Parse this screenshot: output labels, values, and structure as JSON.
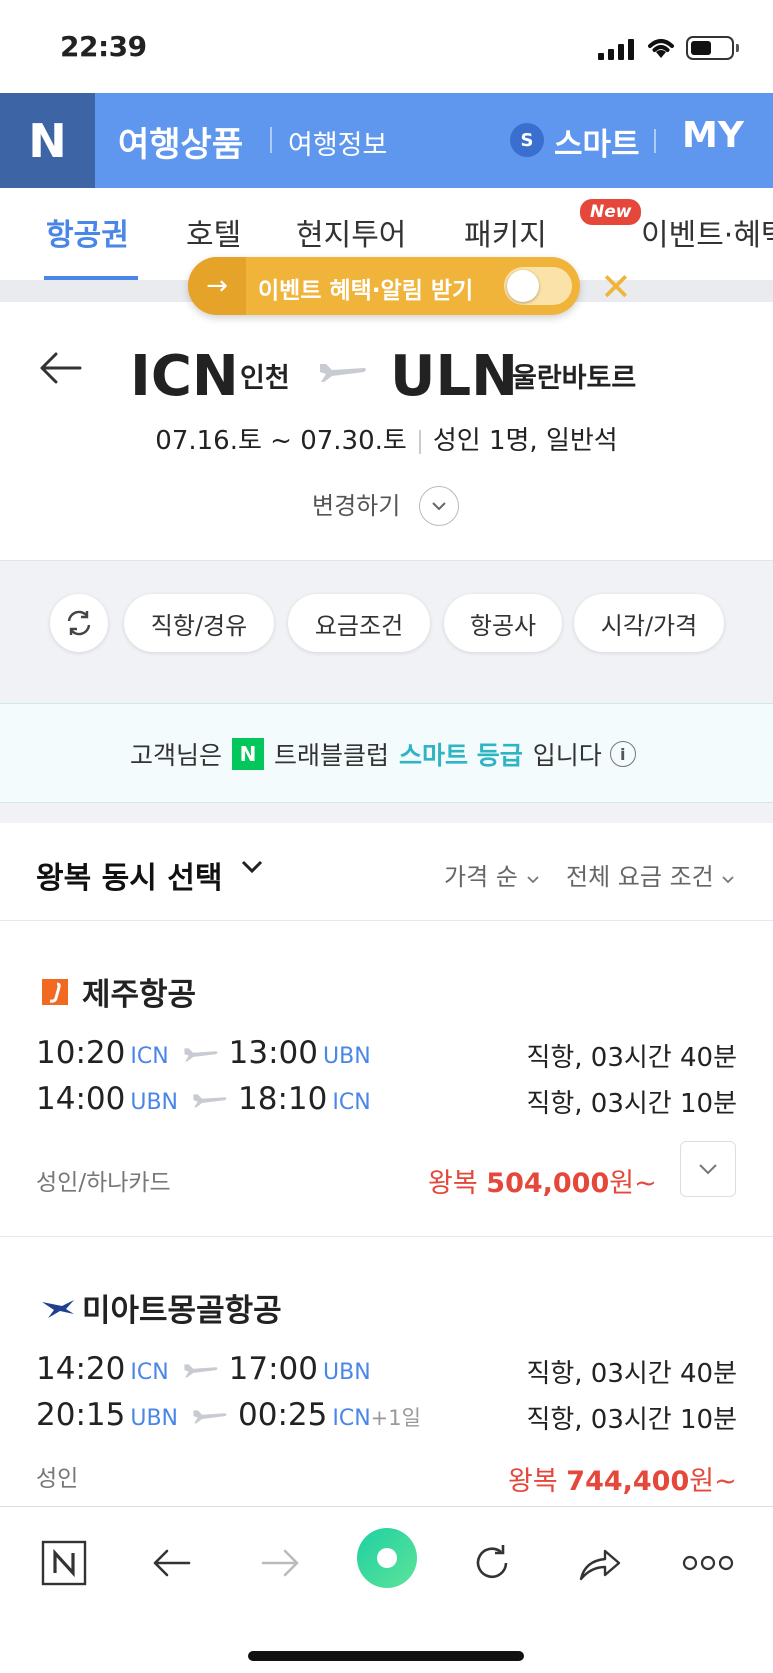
{
  "status": {
    "time": "22:39"
  },
  "header": {
    "logo": "N",
    "title": "여행상품",
    "sub": "여행정보",
    "smart_badge": "S",
    "smart": "스마트",
    "my": "MY"
  },
  "tabs": [
    {
      "label": "항공권",
      "active": true
    },
    {
      "label": "호텔"
    },
    {
      "label": "현지투어"
    },
    {
      "label": "패키지"
    },
    {
      "label": "이벤트·혜택",
      "badge": "New"
    }
  ],
  "event_pill": {
    "label": "이벤트 혜택·알림 받기",
    "toggle_on": false
  },
  "route": {
    "from_code": "ICN",
    "from_city": "인천",
    "to_code": "ULN",
    "to_city": "울란바토르",
    "dates": "07.16.토 ~ 07.30.토",
    "passengers": "성인 1명, 일반석",
    "change": "변경하기"
  },
  "filters": [
    "직항/경유",
    "요금조건",
    "항공사",
    "시각/가격"
  ],
  "grade": {
    "prefix": "고객님은",
    "n": "N",
    "club": "트래블클럽",
    "level": "스마트 등급",
    "suffix": "입니다"
  },
  "sort": {
    "title": "왕복 동시 선택",
    "price_order": "가격 순",
    "fare_cond": "전체 요금 조건"
  },
  "results": [
    {
      "airline": "제주항공",
      "outbound": {
        "dep": "10:20",
        "dep_ap": "ICN",
        "arr": "13:00",
        "arr_ap": "UBN",
        "duration": "직항, 03시간 40분"
      },
      "inbound": {
        "dep": "14:00",
        "dep_ap": "UBN",
        "arr": "18:10",
        "arr_ap": "ICN",
        "plus": "",
        "duration": "직항, 03시간 10분"
      },
      "fare_type": "성인/하나카드",
      "price_prefix": "왕복",
      "price": "504,000",
      "price_suffix": "원~"
    },
    {
      "airline": "미아트몽골항공",
      "outbound": {
        "dep": "14:20",
        "dep_ap": "ICN",
        "arr": "17:00",
        "arr_ap": "UBN",
        "duration": "직항, 03시간 40분"
      },
      "inbound": {
        "dep": "20:15",
        "dep_ap": "UBN",
        "arr": "00:25",
        "arr_ap": "ICN",
        "plus": "+1일",
        "duration": "직항, 03시간 10분"
      },
      "fare_type": "성인",
      "price_prefix": "왕복",
      "price": "744,400",
      "price_suffix": "원~"
    }
  ],
  "bottom_nav": {
    "n": "N"
  },
  "colors": {
    "brand_blue": "#5f97ee",
    "accent_blue": "#4a86e8",
    "price_red": "#e5473a",
    "event_yellow": "#f1b43a",
    "naver_green": "#03c75a"
  }
}
